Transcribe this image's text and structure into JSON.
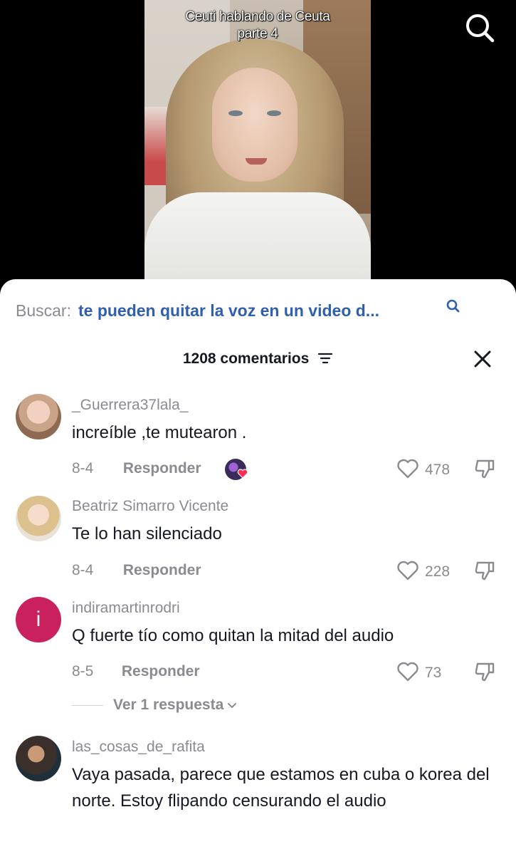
{
  "video": {
    "caption_line1": "Ceuti hablando de Ceuta",
    "caption_line2": "parte 4"
  },
  "search": {
    "label": "Buscar:",
    "query": "te pueden quitar la voz en un video d..."
  },
  "comments_header": {
    "count_label": "1208 comentarios"
  },
  "comments": [
    {
      "username": "_Guerrera37lala_",
      "text": "increíble ,te mutearon .",
      "date": "8-4",
      "reply_label": "Responder",
      "likes": "478",
      "creator_liked": true
    },
    {
      "username": "Beatriz Simarro Vicente",
      "text": "Te lo han silenciado",
      "date": "8-4",
      "reply_label": "Responder",
      "likes": "228"
    },
    {
      "username": "indiramartinrodri",
      "avatar_letter": "i",
      "text": "Q fuerte tío como quitan la mitad del audio",
      "date": "8-5",
      "reply_label": "Responder",
      "likes": "73",
      "view_replies": "Ver 1 respuesta"
    },
    {
      "username": "las_cosas_de_rafita",
      "text": "Vaya pasada, parece que estamos en cuba o korea del norte. Estoy flipando censurando el audio"
    }
  ],
  "icons": {
    "search": "search-icon",
    "filter": "filter-icon",
    "close": "close-icon",
    "like": "heart-outline-icon",
    "dislike": "thumbs-down-icon",
    "chevron": "chevron-down-icon"
  },
  "colors": {
    "search_query": "#2f5fad",
    "muted_text": "#8a8b91",
    "primary_text": "#161823",
    "avatar_letter_bg": "#c8215d",
    "creator_heart": "#fe2c55"
  }
}
